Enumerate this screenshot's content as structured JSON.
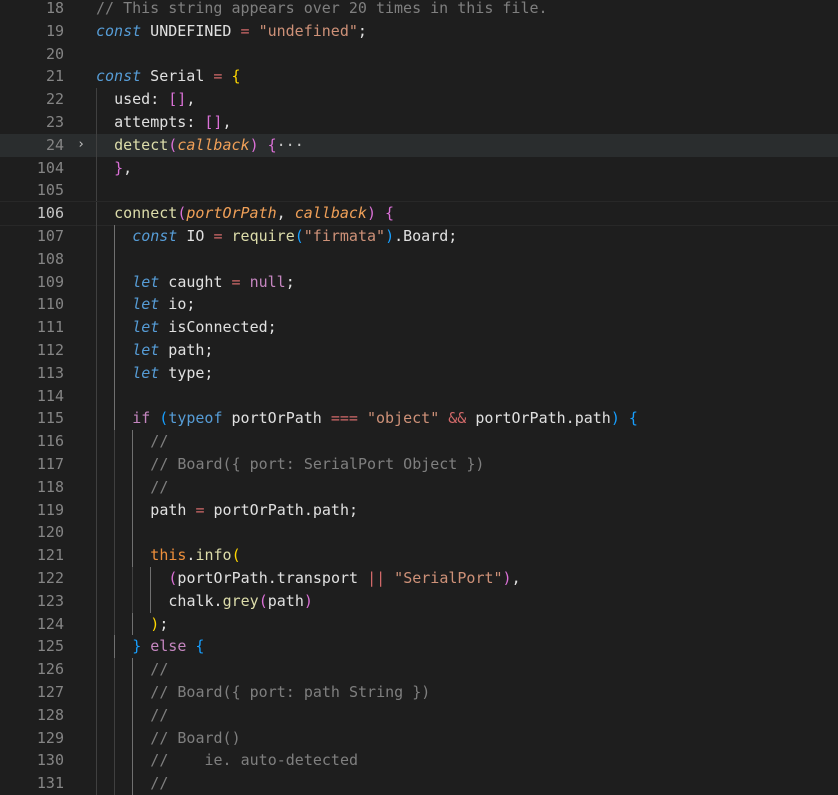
{
  "editor": {
    "lines": [
      {
        "num": "18",
        "tokens": [
          {
            "t": "// This string appears over 20 times in this file.",
            "c": "t-comment grey"
          }
        ]
      },
      {
        "num": "19",
        "tokens": [
          {
            "t": "const",
            "c": "t-store"
          },
          {
            "t": " UNDEFINED ",
            "c": "t-var"
          },
          {
            "t": "=",
            "c": "t-op"
          },
          {
            "t": " ",
            "c": ""
          },
          {
            "t": "\"undefined\"",
            "c": "t-str"
          },
          {
            "t": ";",
            "c": "t-var"
          }
        ]
      },
      {
        "num": "20",
        "tokens": []
      },
      {
        "num": "21",
        "tokens": [
          {
            "t": "const",
            "c": "t-store"
          },
          {
            "t": " Serial ",
            "c": "t-var"
          },
          {
            "t": "=",
            "c": "t-op"
          },
          {
            "t": " ",
            "c": ""
          },
          {
            "t": "{",
            "c": "t-br1"
          }
        ]
      },
      {
        "num": "22",
        "indent": 1,
        "tokens": [
          {
            "t": "used: ",
            "c": "t-prop"
          },
          {
            "t": "[]",
            "c": "t-br2"
          },
          {
            "t": ",",
            "c": "t-var"
          }
        ]
      },
      {
        "num": "23",
        "indent": 1,
        "tokens": [
          {
            "t": "attempts: ",
            "c": "t-prop"
          },
          {
            "t": "[]",
            "c": "t-br2"
          },
          {
            "t": ",",
            "c": "t-var"
          }
        ]
      },
      {
        "num": "24",
        "indent": 1,
        "fold": "›",
        "highlight": true,
        "tokens": [
          {
            "t": "detect",
            "c": "t-fn"
          },
          {
            "t": "(",
            "c": "t-br2"
          },
          {
            "t": "callback",
            "c": "t-param"
          },
          {
            "t": ")",
            "c": "t-br2"
          },
          {
            "t": " ",
            "c": ""
          },
          {
            "t": "{",
            "c": "t-br2"
          },
          {
            "t": "···",
            "c": "t-fold"
          }
        ]
      },
      {
        "num": "104",
        "indent": 1,
        "tokens": [
          {
            "t": "}",
            "c": "t-br2"
          },
          {
            "t": ",",
            "c": "t-var"
          }
        ]
      },
      {
        "num": "105",
        "indent": 1,
        "tokens": []
      },
      {
        "num": "106",
        "indent": 1,
        "current": true,
        "tokens": [
          {
            "t": "connect",
            "c": "t-fn"
          },
          {
            "t": "(",
            "c": "t-br2"
          },
          {
            "t": "portOrPath",
            "c": "t-param"
          },
          {
            "t": ", ",
            "c": "t-var"
          },
          {
            "t": "callback",
            "c": "t-param"
          },
          {
            "t": ")",
            "c": "t-br2"
          },
          {
            "t": " ",
            "c": ""
          },
          {
            "t": "{",
            "c": "t-br2"
          }
        ]
      },
      {
        "num": "107",
        "indent": 2,
        "tokens": [
          {
            "t": "const",
            "c": "t-store"
          },
          {
            "t": " IO ",
            "c": "t-var"
          },
          {
            "t": "=",
            "c": "t-op"
          },
          {
            "t": " ",
            "c": ""
          },
          {
            "t": "require",
            "c": "t-fn"
          },
          {
            "t": "(",
            "c": "t-br3"
          },
          {
            "t": "\"firmata\"",
            "c": "t-str"
          },
          {
            "t": ")",
            "c": "t-br3"
          },
          {
            "t": ".Board;",
            "c": "t-var"
          }
        ]
      },
      {
        "num": "108",
        "indent": 2,
        "tokens": []
      },
      {
        "num": "109",
        "indent": 2,
        "tokens": [
          {
            "t": "let",
            "c": "t-store"
          },
          {
            "t": " caught ",
            "c": "t-var"
          },
          {
            "t": "=",
            "c": "t-op"
          },
          {
            "t": " ",
            "c": ""
          },
          {
            "t": "null",
            "c": "t-null"
          },
          {
            "t": ";",
            "c": "t-var"
          }
        ]
      },
      {
        "num": "110",
        "indent": 2,
        "tokens": [
          {
            "t": "let",
            "c": "t-store"
          },
          {
            "t": " io;",
            "c": "t-var"
          }
        ]
      },
      {
        "num": "111",
        "indent": 2,
        "tokens": [
          {
            "t": "let",
            "c": "t-store"
          },
          {
            "t": " isConnected;",
            "c": "t-var"
          }
        ]
      },
      {
        "num": "112",
        "indent": 2,
        "tokens": [
          {
            "t": "let",
            "c": "t-store"
          },
          {
            "t": " path;",
            "c": "t-var"
          }
        ]
      },
      {
        "num": "113",
        "indent": 2,
        "tokens": [
          {
            "t": "let",
            "c": "t-store"
          },
          {
            "t": " type;",
            "c": "t-var"
          }
        ]
      },
      {
        "num": "114",
        "indent": 2,
        "tokens": []
      },
      {
        "num": "115",
        "indent": 2,
        "tokens": [
          {
            "t": "if",
            "c": "t-kw"
          },
          {
            "t": " ",
            "c": ""
          },
          {
            "t": "(",
            "c": "t-br3"
          },
          {
            "t": "typeof",
            "c": "t-kw-blue"
          },
          {
            "t": " portOrPath ",
            "c": "t-var"
          },
          {
            "t": "===",
            "c": "t-op"
          },
          {
            "t": " ",
            "c": ""
          },
          {
            "t": "\"object\"",
            "c": "t-str"
          },
          {
            "t": " ",
            "c": ""
          },
          {
            "t": "&&",
            "c": "t-op"
          },
          {
            "t": " portOrPath.path",
            "c": "t-var"
          },
          {
            "t": ")",
            "c": "t-br3"
          },
          {
            "t": " ",
            "c": ""
          },
          {
            "t": "{",
            "c": "t-br3"
          }
        ]
      },
      {
        "num": "116",
        "indent": 3,
        "tokens": [
          {
            "t": "//",
            "c": "t-comment grey"
          }
        ]
      },
      {
        "num": "117",
        "indent": 3,
        "tokens": [
          {
            "t": "// Board({ port: SerialPort Object })",
            "c": "t-comment grey"
          }
        ]
      },
      {
        "num": "118",
        "indent": 3,
        "tokens": [
          {
            "t": "//",
            "c": "t-comment grey"
          }
        ]
      },
      {
        "num": "119",
        "indent": 3,
        "tokens": [
          {
            "t": "path ",
            "c": "t-var"
          },
          {
            "t": "=",
            "c": "t-op"
          },
          {
            "t": " portOrPath.path;",
            "c": "t-var"
          }
        ]
      },
      {
        "num": "120",
        "indent": 3,
        "tokens": []
      },
      {
        "num": "121",
        "indent": 3,
        "tokens": [
          {
            "t": "this",
            "c": "t-this"
          },
          {
            "t": ".",
            "c": "t-var"
          },
          {
            "t": "info",
            "c": "t-fn"
          },
          {
            "t": "(",
            "c": "t-br1"
          }
        ]
      },
      {
        "num": "122",
        "indent": 4,
        "tokens": [
          {
            "t": "(",
            "c": "t-br2"
          },
          {
            "t": "portOrPath.transport ",
            "c": "t-var"
          },
          {
            "t": "||",
            "c": "t-op"
          },
          {
            "t": " ",
            "c": ""
          },
          {
            "t": "\"SerialPort\"",
            "c": "t-str"
          },
          {
            "t": ")",
            "c": "t-br2"
          },
          {
            "t": ",",
            "c": "t-var"
          }
        ]
      },
      {
        "num": "123",
        "indent": 4,
        "tokens": [
          {
            "t": "chalk.",
            "c": "t-var"
          },
          {
            "t": "grey",
            "c": "t-fn"
          },
          {
            "t": "(",
            "c": "t-br2"
          },
          {
            "t": "path",
            "c": "t-var"
          },
          {
            "t": ")",
            "c": "t-br2"
          }
        ]
      },
      {
        "num": "124",
        "indent": 3,
        "tokens": [
          {
            "t": ")",
            "c": "t-br1"
          },
          {
            "t": ";",
            "c": "t-var"
          }
        ]
      },
      {
        "num": "125",
        "indent": 2,
        "tokens": [
          {
            "t": "}",
            "c": "t-br3"
          },
          {
            "t": " ",
            "c": ""
          },
          {
            "t": "else",
            "c": "t-kw"
          },
          {
            "t": " ",
            "c": ""
          },
          {
            "t": "{",
            "c": "t-br3"
          }
        ]
      },
      {
        "num": "126",
        "indent": 3,
        "tokens": [
          {
            "t": "//",
            "c": "t-comment grey"
          }
        ]
      },
      {
        "num": "127",
        "indent": 3,
        "tokens": [
          {
            "t": "// Board({ port: path String })",
            "c": "t-comment grey"
          }
        ]
      },
      {
        "num": "128",
        "indent": 3,
        "tokens": [
          {
            "t": "//",
            "c": "t-comment grey"
          }
        ]
      },
      {
        "num": "129",
        "indent": 3,
        "tokens": [
          {
            "t": "// Board()",
            "c": "t-comment grey"
          }
        ]
      },
      {
        "num": "130",
        "indent": 3,
        "tokens": [
          {
            "t": "//    ie. auto-detected",
            "c": "t-comment grey"
          }
        ]
      },
      {
        "num": "131",
        "indent": 3,
        "tokens": [
          {
            "t": "//",
            "c": "t-comment grey"
          }
        ]
      }
    ]
  }
}
